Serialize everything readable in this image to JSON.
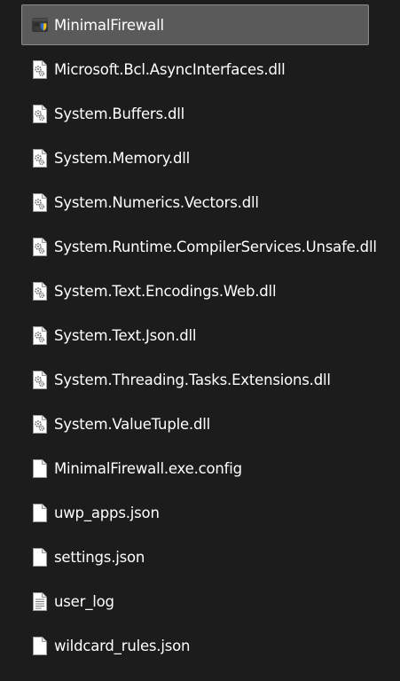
{
  "files": [
    {
      "name": "MinimalFirewall",
      "icon": "application-exe-icon",
      "selected": true
    },
    {
      "name": "Microsoft.Bcl.AsyncInterfaces.dll",
      "icon": "dll-gear-file-icon"
    },
    {
      "name": "System.Buffers.dll",
      "icon": "dll-gear-file-icon"
    },
    {
      "name": "System.Memory.dll",
      "icon": "dll-gear-file-icon"
    },
    {
      "name": "System.Numerics.Vectors.dll",
      "icon": "dll-gear-file-icon"
    },
    {
      "name": "System.Runtime.CompilerServices.Unsafe.dll",
      "icon": "dll-gear-file-icon"
    },
    {
      "name": "System.Text.Encodings.Web.dll",
      "icon": "dll-gear-file-icon"
    },
    {
      "name": "System.Text.Json.dll",
      "icon": "dll-gear-file-icon"
    },
    {
      "name": "System.Threading.Tasks.Extensions.dll",
      "icon": "dll-gear-file-icon"
    },
    {
      "name": "System.ValueTuple.dll",
      "icon": "dll-gear-file-icon"
    },
    {
      "name": "MinimalFirewall.exe.config",
      "icon": "blank-file-icon"
    },
    {
      "name": "uwp_apps.json",
      "icon": "blank-file-icon"
    },
    {
      "name": "settings.json",
      "icon": "blank-file-icon"
    },
    {
      "name": "user_log",
      "icon": "text-file-icon"
    },
    {
      "name": "wildcard_rules.json",
      "icon": "blank-file-icon"
    }
  ],
  "colors": {
    "background": "#1c1c1c",
    "selected_row": "#5a5a5a",
    "text": "#ffffff"
  }
}
